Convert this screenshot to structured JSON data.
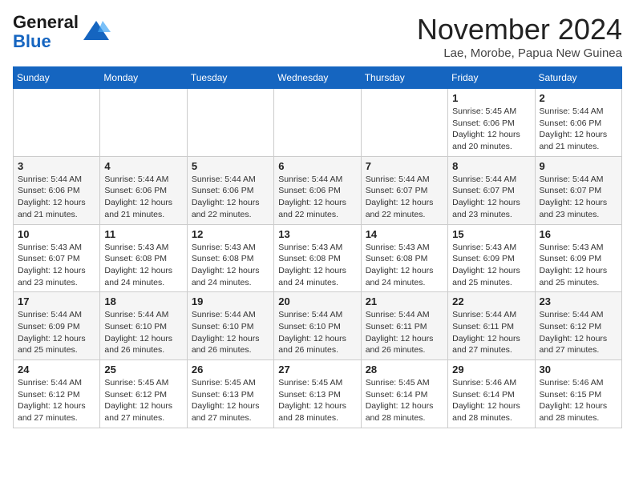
{
  "header": {
    "logo_line1": "General",
    "logo_line2": "Blue",
    "month_title": "November 2024",
    "location": "Lae, Morobe, Papua New Guinea"
  },
  "days_of_week": [
    "Sunday",
    "Monday",
    "Tuesday",
    "Wednesday",
    "Thursday",
    "Friday",
    "Saturday"
  ],
  "weeks": [
    [
      {
        "day": "",
        "info": ""
      },
      {
        "day": "",
        "info": ""
      },
      {
        "day": "",
        "info": ""
      },
      {
        "day": "",
        "info": ""
      },
      {
        "day": "",
        "info": ""
      },
      {
        "day": "1",
        "info": "Sunrise: 5:45 AM\nSunset: 6:06 PM\nDaylight: 12 hours and 20 minutes."
      },
      {
        "day": "2",
        "info": "Sunrise: 5:44 AM\nSunset: 6:06 PM\nDaylight: 12 hours and 21 minutes."
      }
    ],
    [
      {
        "day": "3",
        "info": "Sunrise: 5:44 AM\nSunset: 6:06 PM\nDaylight: 12 hours and 21 minutes."
      },
      {
        "day": "4",
        "info": "Sunrise: 5:44 AM\nSunset: 6:06 PM\nDaylight: 12 hours and 21 minutes."
      },
      {
        "day": "5",
        "info": "Sunrise: 5:44 AM\nSunset: 6:06 PM\nDaylight: 12 hours and 22 minutes."
      },
      {
        "day": "6",
        "info": "Sunrise: 5:44 AM\nSunset: 6:06 PM\nDaylight: 12 hours and 22 minutes."
      },
      {
        "day": "7",
        "info": "Sunrise: 5:44 AM\nSunset: 6:07 PM\nDaylight: 12 hours and 22 minutes."
      },
      {
        "day": "8",
        "info": "Sunrise: 5:44 AM\nSunset: 6:07 PM\nDaylight: 12 hours and 23 minutes."
      },
      {
        "day": "9",
        "info": "Sunrise: 5:44 AM\nSunset: 6:07 PM\nDaylight: 12 hours and 23 minutes."
      }
    ],
    [
      {
        "day": "10",
        "info": "Sunrise: 5:43 AM\nSunset: 6:07 PM\nDaylight: 12 hours and 23 minutes."
      },
      {
        "day": "11",
        "info": "Sunrise: 5:43 AM\nSunset: 6:08 PM\nDaylight: 12 hours and 24 minutes."
      },
      {
        "day": "12",
        "info": "Sunrise: 5:43 AM\nSunset: 6:08 PM\nDaylight: 12 hours and 24 minutes."
      },
      {
        "day": "13",
        "info": "Sunrise: 5:43 AM\nSunset: 6:08 PM\nDaylight: 12 hours and 24 minutes."
      },
      {
        "day": "14",
        "info": "Sunrise: 5:43 AM\nSunset: 6:08 PM\nDaylight: 12 hours and 24 minutes."
      },
      {
        "day": "15",
        "info": "Sunrise: 5:43 AM\nSunset: 6:09 PM\nDaylight: 12 hours and 25 minutes."
      },
      {
        "day": "16",
        "info": "Sunrise: 5:43 AM\nSunset: 6:09 PM\nDaylight: 12 hours and 25 minutes."
      }
    ],
    [
      {
        "day": "17",
        "info": "Sunrise: 5:44 AM\nSunset: 6:09 PM\nDaylight: 12 hours and 25 minutes."
      },
      {
        "day": "18",
        "info": "Sunrise: 5:44 AM\nSunset: 6:10 PM\nDaylight: 12 hours and 26 minutes."
      },
      {
        "day": "19",
        "info": "Sunrise: 5:44 AM\nSunset: 6:10 PM\nDaylight: 12 hours and 26 minutes."
      },
      {
        "day": "20",
        "info": "Sunrise: 5:44 AM\nSunset: 6:10 PM\nDaylight: 12 hours and 26 minutes."
      },
      {
        "day": "21",
        "info": "Sunrise: 5:44 AM\nSunset: 6:11 PM\nDaylight: 12 hours and 26 minutes."
      },
      {
        "day": "22",
        "info": "Sunrise: 5:44 AM\nSunset: 6:11 PM\nDaylight: 12 hours and 27 minutes."
      },
      {
        "day": "23",
        "info": "Sunrise: 5:44 AM\nSunset: 6:12 PM\nDaylight: 12 hours and 27 minutes."
      }
    ],
    [
      {
        "day": "24",
        "info": "Sunrise: 5:44 AM\nSunset: 6:12 PM\nDaylight: 12 hours and 27 minutes."
      },
      {
        "day": "25",
        "info": "Sunrise: 5:45 AM\nSunset: 6:12 PM\nDaylight: 12 hours and 27 minutes."
      },
      {
        "day": "26",
        "info": "Sunrise: 5:45 AM\nSunset: 6:13 PM\nDaylight: 12 hours and 27 minutes."
      },
      {
        "day": "27",
        "info": "Sunrise: 5:45 AM\nSunset: 6:13 PM\nDaylight: 12 hours and 28 minutes."
      },
      {
        "day": "28",
        "info": "Sunrise: 5:45 AM\nSunset: 6:14 PM\nDaylight: 12 hours and 28 minutes."
      },
      {
        "day": "29",
        "info": "Sunrise: 5:46 AM\nSunset: 6:14 PM\nDaylight: 12 hours and 28 minutes."
      },
      {
        "day": "30",
        "info": "Sunrise: 5:46 AM\nSunset: 6:15 PM\nDaylight: 12 hours and 28 minutes."
      }
    ]
  ]
}
